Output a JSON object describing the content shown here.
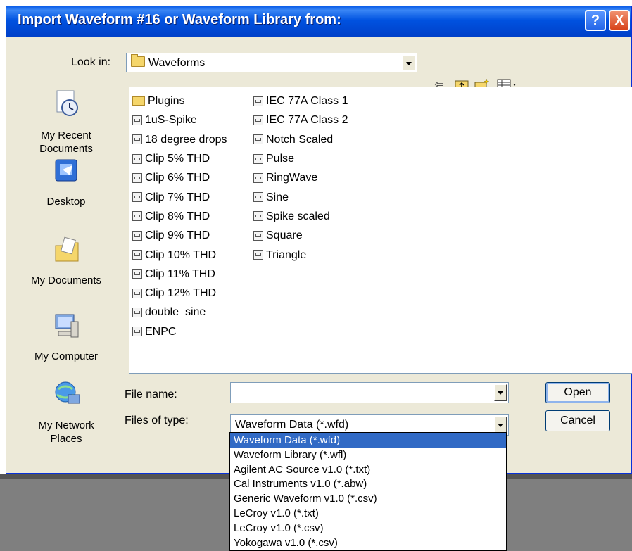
{
  "window": {
    "title": "Import Waveform #16 or Waveform Library from:",
    "help_label": "?",
    "close_label": "X"
  },
  "look_in": {
    "label": "Look in:",
    "value": "Waveforms"
  },
  "places": [
    {
      "label_1": "My Recent",
      "label_2": "Documents",
      "icon": "recent-documents-icon"
    },
    {
      "label_1": "Desktop",
      "label_2": "",
      "icon": "desktop-icon"
    },
    {
      "label_1": "My Documents",
      "label_2": "",
      "icon": "my-documents-icon"
    },
    {
      "label_1": "My Computer",
      "label_2": "",
      "icon": "my-computer-icon"
    },
    {
      "label_1": "My Network",
      "label_2": "Places",
      "icon": "network-places-icon"
    }
  ],
  "files_col1": [
    "Plugins",
    "1uS-Spike",
    "18 degree drops",
    "Clip 5% THD",
    "Clip 6% THD",
    "Clip 7% THD",
    "Clip 8% THD",
    "Clip 9% THD",
    "Clip 10% THD",
    "Clip 11% THD",
    "Clip 12% THD",
    "double_sine",
    "ENPC"
  ],
  "files_col2": [
    "IEC 77A Class 1",
    "IEC 77A Class 2",
    "Notch Scaled",
    "Pulse",
    "RingWave",
    "Sine",
    "Spike scaled",
    "Square",
    "Triangle"
  ],
  "file_name": {
    "label": "File name:",
    "value": ""
  },
  "file_type": {
    "label": "Files of type:",
    "value": "Waveform Data (*.wfd)",
    "options": [
      "Waveform Data (*.wfd)",
      "Waveform Library (*.wfl)",
      "Agilent AC Source v1.0 (*.txt)",
      "Cal Instruments v1.0 (*.abw)",
      "Generic Waveform v1.0 (*.csv)",
      "LeCroy v1.0 (*.txt)",
      "LeCroy v1.0 (*.csv)",
      "Yokogawa v1.0 (*.csv)"
    ]
  },
  "buttons": {
    "open": "Open",
    "cancel": "Cancel"
  }
}
